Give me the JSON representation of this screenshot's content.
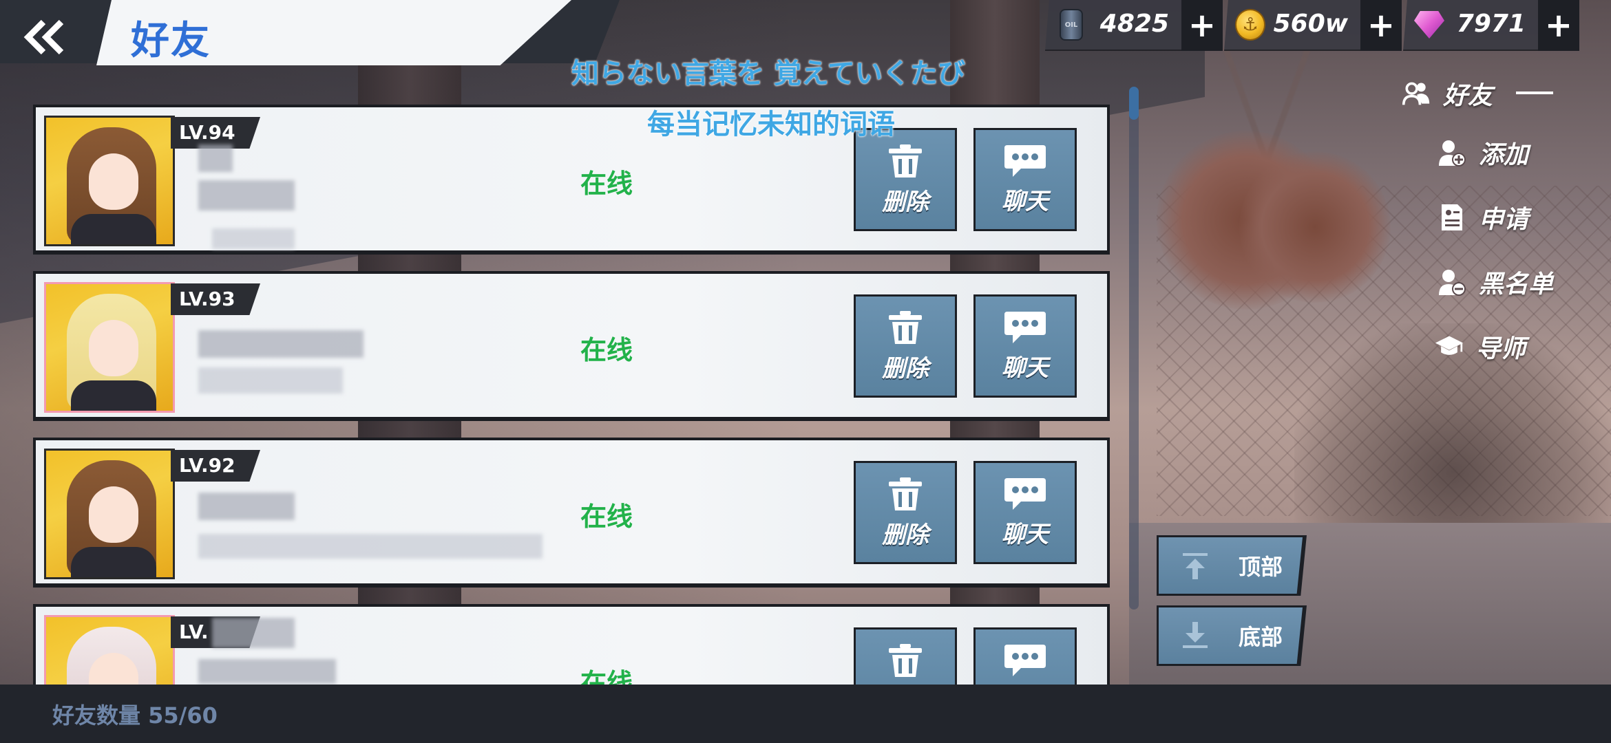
{
  "header": {
    "back_icon": "double-chevron-left-icon",
    "title": "好友"
  },
  "currencies": [
    {
      "name": "oil",
      "icon": "oil-barrel-icon",
      "icon_text": "OIL",
      "amount": "4825",
      "plus": "+"
    },
    {
      "name": "gold",
      "icon": "anchor-coin-icon",
      "icon_text": "⚓",
      "amount": "560w",
      "plus": "+"
    },
    {
      "name": "gem",
      "icon": "diamond-gem-icon",
      "amount": "7971",
      "plus": "+"
    }
  ],
  "lyrics": {
    "japanese": "知らない言葉を 覚えていくたび",
    "chinese": "每当记忆未知的词语"
  },
  "friends": [
    {
      "level": "LV.94",
      "status": "在线",
      "delete_label": "删除",
      "chat_label": "聊天"
    },
    {
      "level": "LV.93",
      "status": "在线",
      "delete_label": "删除",
      "chat_label": "聊天"
    },
    {
      "level": "LV.92",
      "status": "在线",
      "delete_label": "删除",
      "chat_label": "聊天"
    },
    {
      "level": "LV.",
      "status": "在线",
      "delete_label": "删除",
      "chat_label": "聊天"
    }
  ],
  "side_menu": {
    "friends": "好友",
    "add": "添加",
    "requests": "申请",
    "blacklist": "黑名单",
    "mentor": "导师"
  },
  "nav_buttons": {
    "top": "顶部",
    "bottom": "底部"
  },
  "footer": {
    "friend_count": "好友数量 55/60"
  },
  "colors": {
    "title_blue": "#2f6fd6",
    "online_green": "#22b24a",
    "button_steel_blue": "#6c93b1",
    "lyric_blue": "#3fa7e4"
  }
}
